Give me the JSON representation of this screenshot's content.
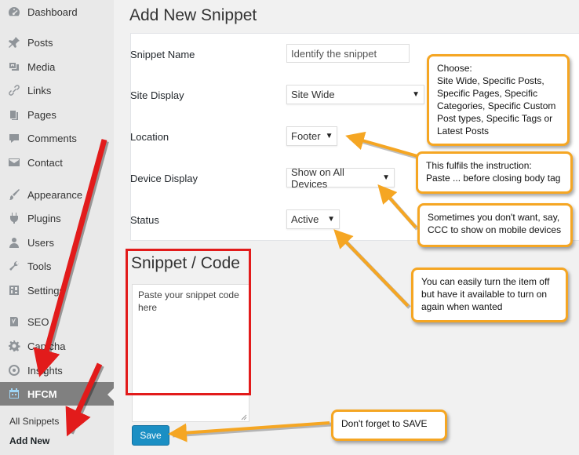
{
  "sidebar": {
    "items": [
      {
        "label": "Dashboard",
        "icon": "dashboard-icon"
      },
      {
        "label": "Posts",
        "icon": "pin-icon"
      },
      {
        "label": "Media",
        "icon": "media-icon"
      },
      {
        "label": "Links",
        "icon": "link-icon"
      },
      {
        "label": "Pages",
        "icon": "pages-icon"
      },
      {
        "label": "Comments",
        "icon": "comment-icon"
      },
      {
        "label": "Contact",
        "icon": "mail-icon"
      },
      {
        "label": "Appearance",
        "icon": "brush-icon"
      },
      {
        "label": "Plugins",
        "icon": "plugin-icon"
      },
      {
        "label": "Users",
        "icon": "user-icon"
      },
      {
        "label": "Tools",
        "icon": "wrench-icon"
      },
      {
        "label": "Settings",
        "icon": "settings-icon"
      },
      {
        "label": "SEO",
        "icon": "seo-icon"
      },
      {
        "label": "Captcha",
        "icon": "gear-icon"
      },
      {
        "label": "Insights",
        "icon": "insights-icon"
      },
      {
        "label": "HFCM",
        "icon": "calendar-icon"
      }
    ],
    "submenu": [
      "All Snippets",
      "Add New"
    ]
  },
  "page": {
    "title": "Add New Snippet"
  },
  "form": {
    "snippet_name": {
      "label": "Snippet Name",
      "placeholder": "Identify the snippet"
    },
    "site_display": {
      "label": "Site Display",
      "value": "Site Wide"
    },
    "location": {
      "label": "Location",
      "value": "Footer"
    },
    "device_display": {
      "label": "Device Display",
      "value": "Show on All Devices"
    },
    "status": {
      "label": "Status",
      "value": "Active"
    }
  },
  "code": {
    "heading": "Snippet / Code",
    "placeholder": "Paste your snippet code here"
  },
  "save_label": "Save",
  "callouts": {
    "choose": [
      "Choose:",
      "Site Wide, Specific Posts,",
      "Specific Pages, Specific",
      "Categories, Specific Custom",
      "Post types, Specific Tags or",
      "Latest Posts"
    ],
    "footer": [
      "This fulfils the instruction:",
      "Paste ... before closing body tag"
    ],
    "device": [
      "Sometimes you don't want, say,",
      "CCC to show on mobile devices"
    ],
    "status": [
      "You can easily turn the item off",
      "but have it available to turn on",
      "again when wanted"
    ],
    "save": [
      "Don't forget to SAVE"
    ]
  },
  "colors": {
    "callout_border": "#f5a623",
    "arrow": "#e21b1b",
    "save_button": "#1b8fc4"
  }
}
